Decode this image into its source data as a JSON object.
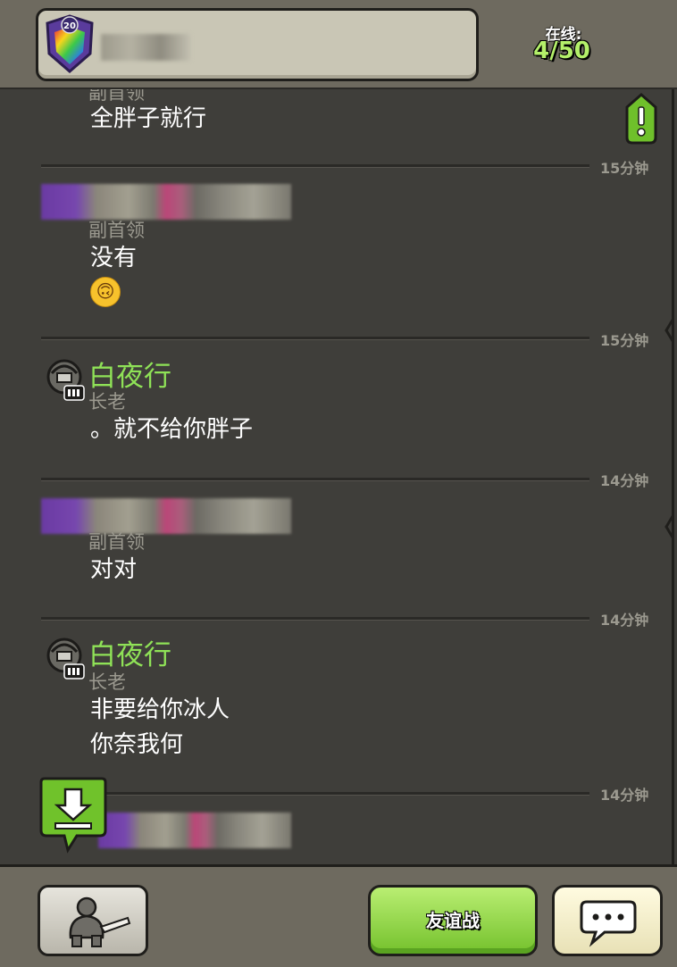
{
  "header": {
    "clan_level": "20",
    "online_label": "在线:",
    "online_count": "4/50"
  },
  "messages": [
    {
      "rank": "副首领",
      "text": "全胖子就行",
      "time": "15分钟"
    },
    {
      "rank": "副首领",
      "text": "没有",
      "emoji": "🙃",
      "time": "15分钟"
    },
    {
      "name": "白夜行",
      "rank": "长老",
      "text": "。就不给你胖子",
      "time": "14分钟"
    },
    {
      "rank": "副首领",
      "text": "对对",
      "time": "14分钟"
    },
    {
      "name": "白夜行",
      "rank": "长老",
      "text": "非要给你冰人\n你奈我何",
      "time": "14分钟"
    }
  ],
  "last_time": "14分钟",
  "footer": {
    "friendly_battle_label": "友谊战"
  },
  "icons": {
    "alert": "exclamation-icon",
    "download": "download-icon",
    "army": "barbarian-icon",
    "chat": "speech-bubble-icon",
    "elder_avatar": "elder-helmet-icon"
  },
  "colors": {
    "background": "#3f3e3a",
    "name_green": "#8fe257",
    "button_green": "#74c12c"
  }
}
